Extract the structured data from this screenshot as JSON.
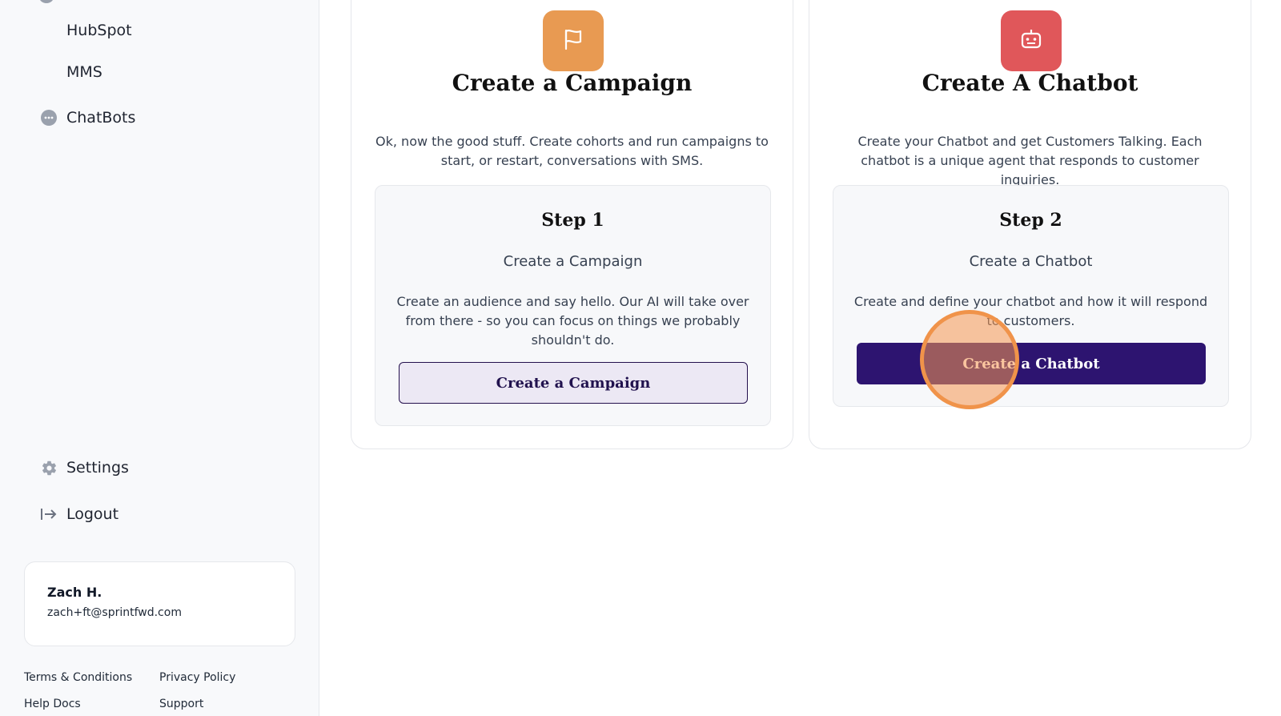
{
  "sidebar": {
    "sub_items": [
      {
        "label": "HubSpot"
      },
      {
        "label": "MMS"
      }
    ],
    "chatbots_label": "ChatBots",
    "settings_label": "Settings",
    "logout_label": "Logout",
    "user": {
      "name": "Zach H.",
      "email": "zach+ft@sprintfwd.com"
    },
    "footer_links": [
      "Terms & Conditions",
      "Privacy Policy",
      "Help Docs",
      "Support"
    ]
  },
  "cards": [
    {
      "icon": "flag-icon",
      "icon_color": "#e89a52",
      "title": "Create a Campaign",
      "description": "Ok, now the good stuff. Create cohorts and run campaigns to start, or restart, conversations with SMS.",
      "step_title": "Step 1",
      "step_subtitle": "Create a Campaign",
      "step_text": "Create an audience and say hello. Our AI will take over from there - so you can focus on things we probably shouldn't do.",
      "button_label": "Create a Campaign"
    },
    {
      "icon": "robot-icon",
      "icon_color": "#e0575a",
      "title": "Create A Chatbot",
      "description": "Create your Chatbot and get Customers Talking. Each chatbot is a unique agent that responds to customer inquiries.",
      "step_title": "Step 2",
      "step_subtitle": "Create a Chatbot",
      "step_text": "Create and define your chatbot and how it will respond to customers.",
      "button_label": "Create a Chatbot"
    }
  ]
}
